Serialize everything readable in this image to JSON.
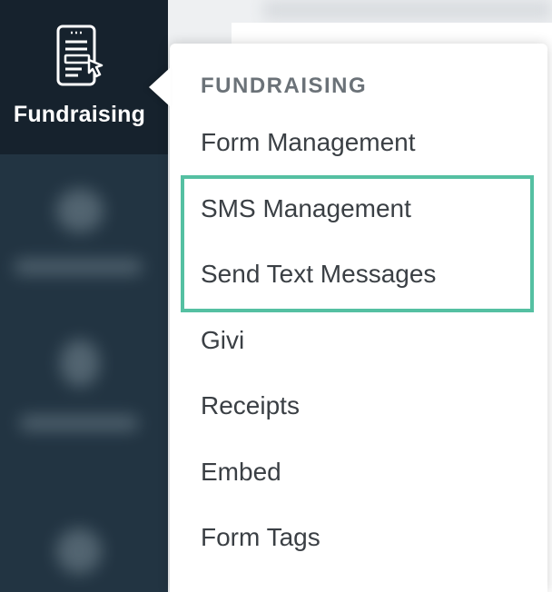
{
  "sidebar": {
    "active_item": {
      "label": "Fundraising",
      "icon": "form-document-icon"
    },
    "blurred_items": [
      {
        "icon": "blurred-icon"
      },
      {
        "icon": "blurred-icon"
      },
      {
        "icon": "blurred-icon"
      }
    ]
  },
  "menu": {
    "heading": "FUNDRAISING",
    "items": [
      {
        "label": "Form Management"
      },
      {
        "label": "SMS Management"
      },
      {
        "label": "Send Text Messages"
      },
      {
        "label": "Givi"
      },
      {
        "label": "Receipts"
      },
      {
        "label": "Embed"
      },
      {
        "label": "Form Tags"
      }
    ]
  },
  "colors": {
    "sidebar_bg": "#223442",
    "sidebar_active_bg": "#16222d",
    "highlight_border": "#55c0a2",
    "menu_text": "#3a3f44",
    "menu_heading": "#6b7278"
  }
}
